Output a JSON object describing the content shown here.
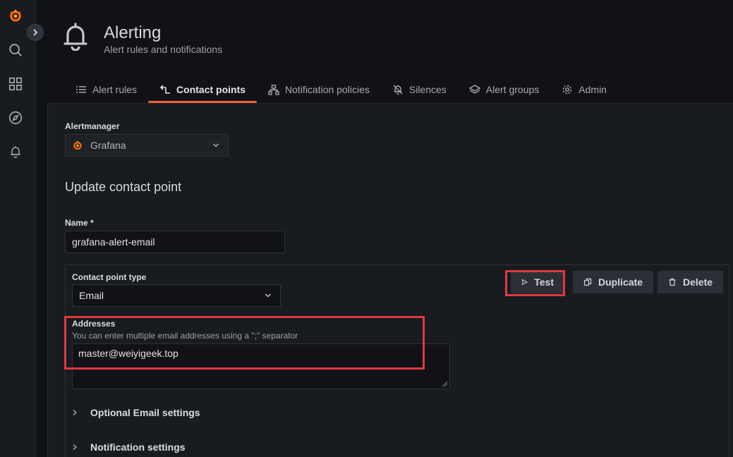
{
  "header": {
    "title": "Alerting",
    "subtitle": "Alert rules and notifications"
  },
  "tabs": [
    {
      "label": "Alert rules",
      "icon": "list-icon"
    },
    {
      "label": "Contact points",
      "icon": "contact-points-icon",
      "active": true
    },
    {
      "label": "Notification policies",
      "icon": "sitemap-icon"
    },
    {
      "label": "Silences",
      "icon": "bell-slash-icon"
    },
    {
      "label": "Alert groups",
      "icon": "layers-icon"
    },
    {
      "label": "Admin",
      "icon": "cog-icon"
    }
  ],
  "alertmanager": {
    "label": "Alertmanager",
    "value": "Grafana"
  },
  "form": {
    "heading": "Update contact point",
    "name_label": "Name *",
    "name_value": "grafana-alert-email",
    "type_label": "Contact point type",
    "type_value": "Email",
    "addresses_label": "Addresses",
    "addresses_desc": "You can enter multiple email addresses using a \";\" separator",
    "addresses_value": "master@weiyigeek.top",
    "optional_settings": "Optional Email settings",
    "notification_settings": "Notification settings"
  },
  "buttons": {
    "test": "Test",
    "duplicate": "Duplicate",
    "delete": "Delete"
  },
  "colors": {
    "accent": "#f55f3e",
    "highlight": "#e0393e",
    "background": "#111217",
    "panel": "#181b1f"
  }
}
